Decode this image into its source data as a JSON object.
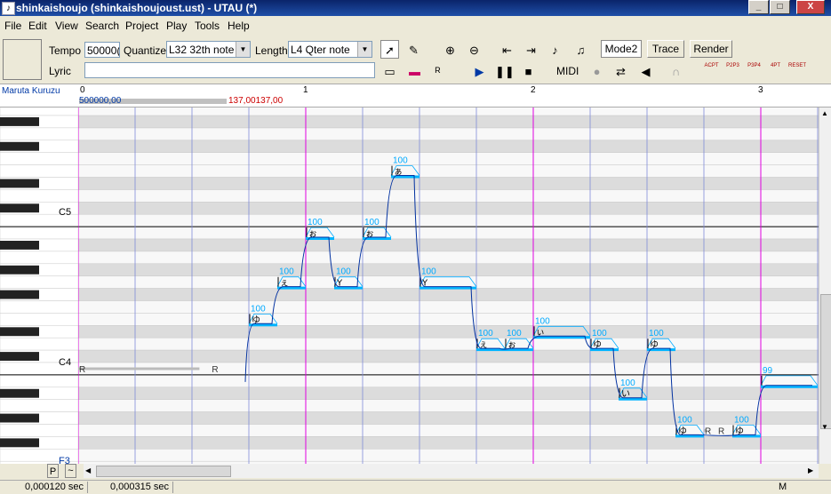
{
  "window": {
    "title": "shinkaishoujo (shinkaishoujoust.ust) - UTAU (*)",
    "min_label": "_",
    "max_label": "□",
    "close_label": "X"
  },
  "menu": [
    "File",
    "Edit",
    "View",
    "Search",
    "Project",
    "Play",
    "Tools",
    "Help"
  ],
  "toolbar": {
    "tempo_label": "Tempo",
    "tempo_value": "50000(",
    "quantize_label": "Quantize",
    "quantize_value": "L32 32th note",
    "length_label": "Length",
    "length_value": "L4  Qter note",
    "lyric_label": "Lyric",
    "lyric_value": "",
    "mode_button": "Mode2",
    "trace_button": "Trace",
    "render_button": "Render",
    "midi_label": "MIDI",
    "edit_tools": [
      "arrow-tool-icon",
      "pencil-tool-icon",
      "zoom-in-icon",
      "zoom-out-icon",
      "jump-start-icon",
      "jump-end-icon",
      "insert-note-icon",
      "split-note-icon"
    ],
    "row2_icons": [
      "insert-rest-icon",
      "insert-envelope-icon",
      "insert-r-icon"
    ],
    "play_icons": [
      "play-icon",
      "pause-icon",
      "stop-icon"
    ],
    "right_icons": [
      "record-icon",
      "loop-icon",
      "speaker-icon",
      "headphone-icon"
    ],
    "plugin_labels": [
      "ACPT",
      "P2P3",
      "P3P4",
      "4PT",
      "RESET"
    ]
  },
  "ruler": {
    "singer": "Maruta Kuruzu",
    "measures": [
      "0",
      "1",
      "2",
      "3"
    ],
    "tempo_readout": "500000,00",
    "tempo_readout2": "137,00137,00"
  },
  "piano": {
    "labels": [
      "C5",
      "C4",
      "F3"
    ]
  },
  "roll": {
    "rest_lyric": "R",
    "notes": [
      {
        "lyric": "R",
        "vel": "",
        "start": 0,
        "len": 2.6,
        "pitch": 0
      },
      {
        "lyric": "ゆ",
        "vel": "100",
        "start": 3.0,
        "len": 0.5,
        "pitch": 4
      },
      {
        "lyric": "ぇ",
        "vel": "100",
        "start": 3.5,
        "len": 0.5,
        "pitch": 7
      },
      {
        "lyric": "ぉ",
        "vel": "100",
        "start": 4.0,
        "len": 0.5,
        "pitch": 11
      },
      {
        "lyric": "Y",
        "vel": "100",
        "start": 4.5,
        "len": 0.5,
        "pitch": 7
      },
      {
        "lyric": "ぉ",
        "vel": "100",
        "start": 5.0,
        "len": 0.5,
        "pitch": 11
      },
      {
        "lyric": "ぁ",
        "vel": "100",
        "start": 5.5,
        "len": 0.5,
        "pitch": 16
      },
      {
        "lyric": "Y",
        "vel": "100",
        "start": 6.0,
        "len": 1.0,
        "pitch": 7
      },
      {
        "lyric": "ぇ",
        "vel": "100",
        "start": 7.0,
        "len": 0.5,
        "pitch": 2
      },
      {
        "lyric": "ぉ",
        "vel": "100",
        "start": 7.5,
        "len": 0.5,
        "pitch": 2
      },
      {
        "lyric": "ぃ",
        "vel": "100",
        "start": 8.0,
        "len": 1.0,
        "pitch": 3
      },
      {
        "lyric": "ゆ",
        "vel": "100",
        "start": 9.0,
        "len": 0.5,
        "pitch": 2
      },
      {
        "lyric": "い",
        "vel": "100",
        "start": 9.5,
        "len": 0.5,
        "pitch": -2
      },
      {
        "lyric": "ゆ",
        "vel": "100",
        "start": 10.0,
        "len": 0.5,
        "pitch": 2
      },
      {
        "lyric": "ゆ",
        "vel": "100",
        "start": 10.5,
        "len": 0.5,
        "pitch": -5
      },
      {
        "lyric": "R",
        "vel": "",
        "start": 11.0,
        "len": 0.5,
        "pitch": -5
      },
      {
        "lyric": "ゆ",
        "vel": "100",
        "start": 11.5,
        "len": 0.5,
        "pitch": -5
      },
      {
        "lyric": "",
        "vel": "99",
        "start": 12.0,
        "len": 1.0,
        "pitch": -1
      }
    ]
  },
  "status": {
    "left_time": "0,000120 sec",
    "mid_time": "0,000315 sec",
    "mode_indicator": "M",
    "p_label": "P",
    "tilde_label": "~"
  }
}
